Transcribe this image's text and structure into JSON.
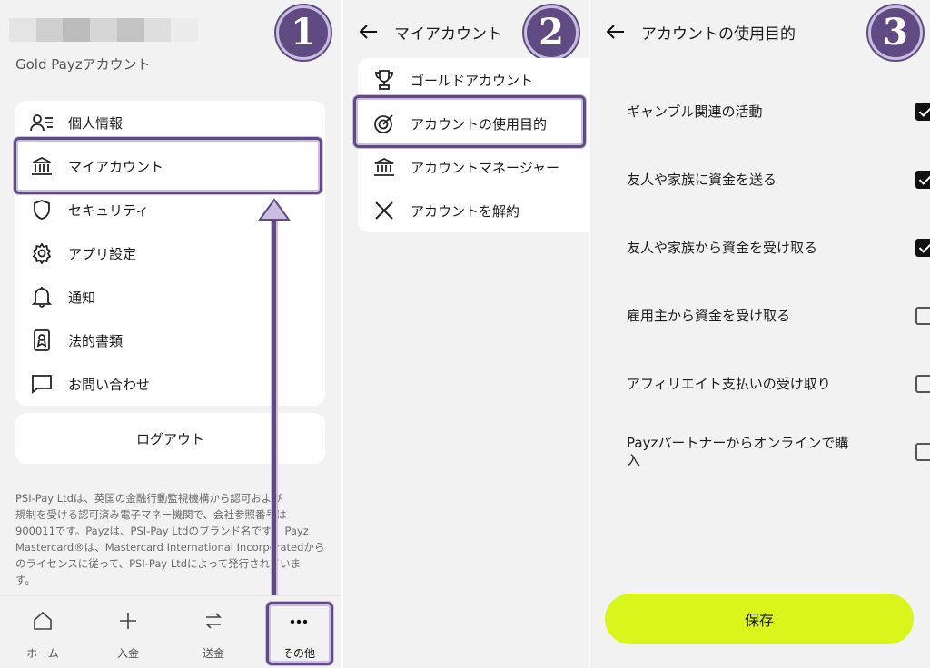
{
  "colors": {
    "accent": "#5f4b82",
    "save": "#d9f51b",
    "panel_bg": "#f2f2f2"
  },
  "panel1": {
    "account_subtitle": "Gold Payzアカウント",
    "badge": "1",
    "menu": [
      {
        "label": "個人情報",
        "icon": "profile-list-icon"
      },
      {
        "label": "マイアカウント",
        "icon": "bank-icon"
      },
      {
        "label": "セキュリティ",
        "icon": "shield-icon"
      },
      {
        "label": "アプリ設定",
        "icon": "gear-icon"
      },
      {
        "label": "通知",
        "icon": "bell-icon"
      },
      {
        "label": "法的書類",
        "icon": "document-icon"
      },
      {
        "label": "お問い合わせ",
        "icon": "chat-icon"
      }
    ],
    "logout": "ログアウト",
    "legal_lines": [
      "PSI-Pay Ltdは、英国の金融行動監視機構から認可および",
      "規制を受ける認可済み電子マネー機関で、会社参照番号は",
      "900011です。Payzは、PSI-Pay Ltdのブランド名です。 Payz",
      "Mastercard®は、Mastercard International Incorporatedから",
      "のライセンスに従って、PSI-Pay Ltdによって発行されていま",
      "す。"
    ],
    "tabs": [
      {
        "label": "ホーム",
        "icon": "home-icon"
      },
      {
        "label": "入金",
        "icon": "plus-icon"
      },
      {
        "label": "送金",
        "icon": "transfer-icon"
      },
      {
        "label": "その他",
        "icon": "more-dots-icon"
      }
    ]
  },
  "panel2": {
    "title": "マイアカウント",
    "badge": "2",
    "items": [
      {
        "label": "ゴールドアカウント",
        "icon": "trophy-icon"
      },
      {
        "label": "アカウントの使用目的",
        "icon": "target-icon"
      },
      {
        "label": "アカウントマネージャー",
        "icon": "bank-icon"
      },
      {
        "label": "アカウントを解約",
        "icon": "close-icon"
      }
    ]
  },
  "panel3": {
    "title": "アカウントの使用目的",
    "badge": "3",
    "options": [
      {
        "label": "ギャンブル関連の活動",
        "checked": true
      },
      {
        "label": "友人や家族に資金を送る",
        "checked": true
      },
      {
        "label": "友人や家族から資金を受け取る",
        "checked": true
      },
      {
        "label": "雇用主から資金を受け取る",
        "checked": false
      },
      {
        "label": "アフィリエイト支払いの受け取り",
        "checked": false
      },
      {
        "label": "Payzパートナーからオンラインで購入",
        "checked": false
      }
    ],
    "save": "保存"
  }
}
